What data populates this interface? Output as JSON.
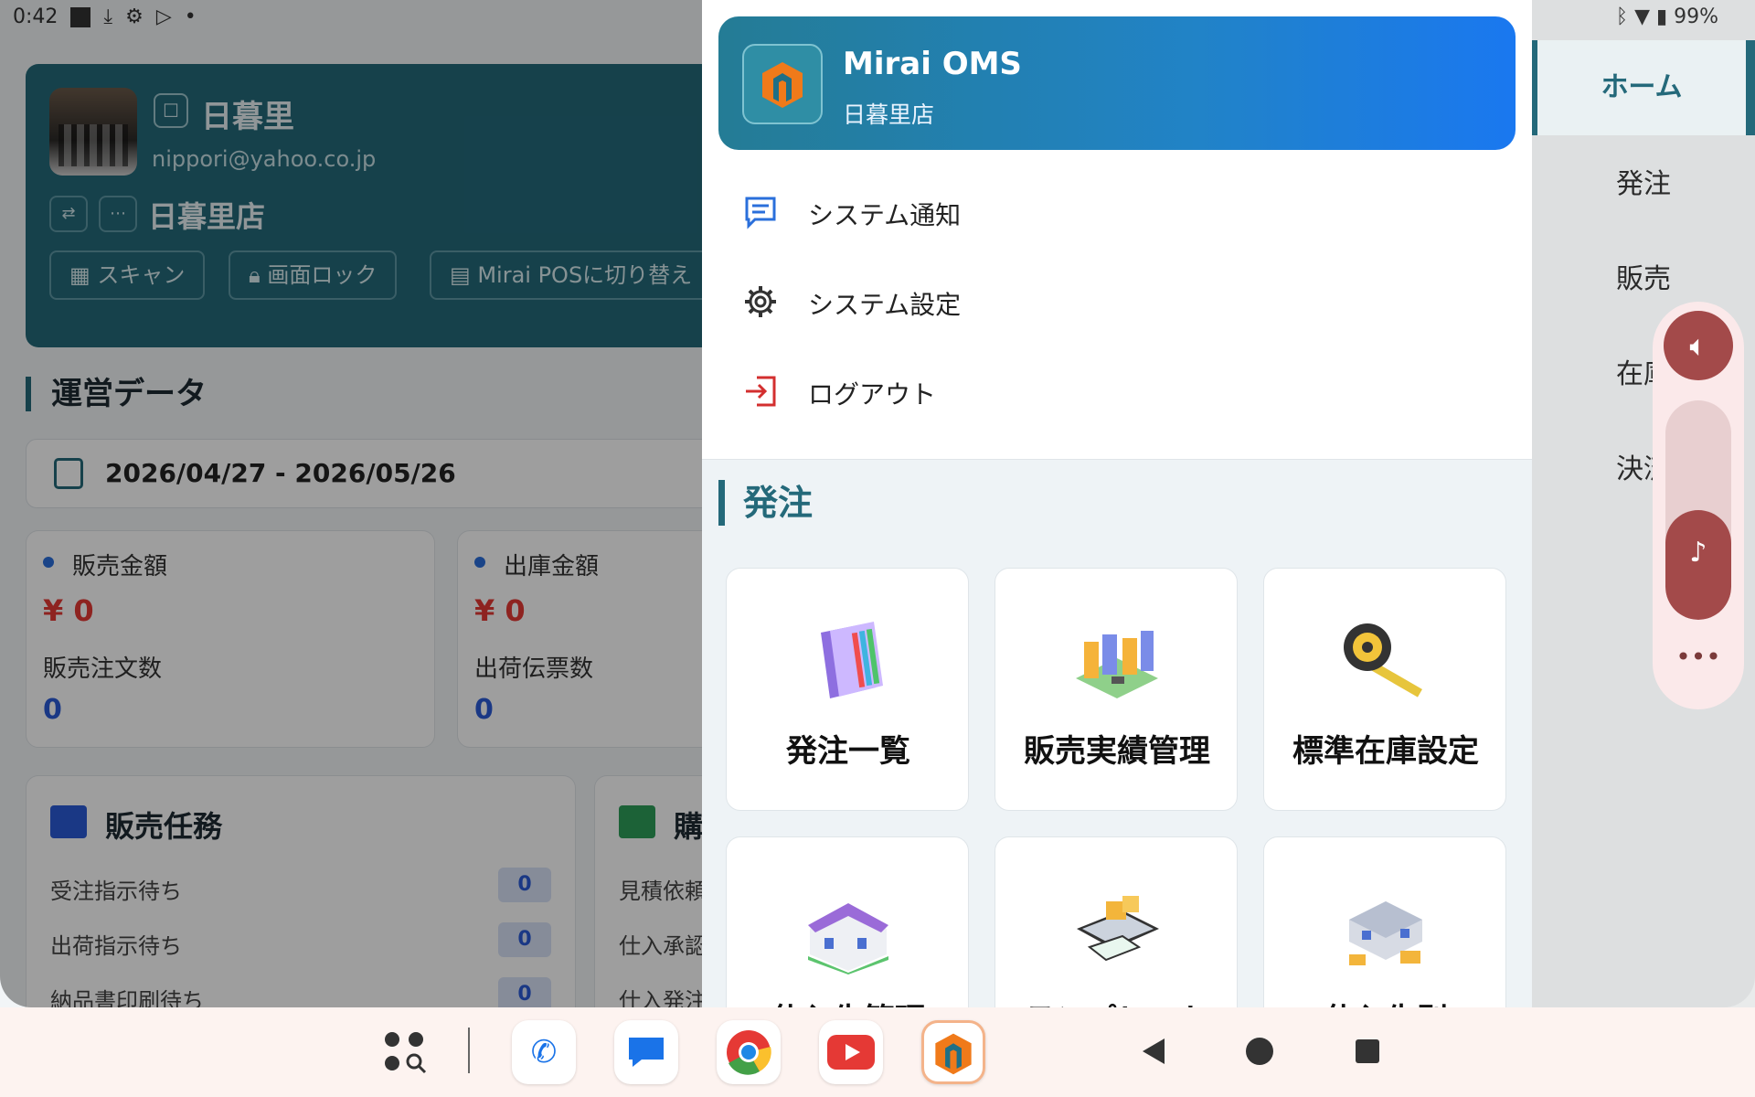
{
  "status_bar": {
    "time": "0:42",
    "battery": "99%"
  },
  "background": {
    "user": {
      "name": "日暮里",
      "email": "nippori@yahoo.co.jp",
      "store": "日暮里店"
    },
    "user_buttons": [
      "スキャン",
      "画面ロック",
      "Mirai POSに切り替え"
    ],
    "section_title": "運営データ",
    "date_range": "2026/04/27 - 2026/05/26",
    "stats": [
      {
        "label": "販売金額",
        "amount": "¥ 0",
        "sub_label": "販売注文数",
        "count": "0"
      },
      {
        "label": "出庫金額",
        "amount": "¥ 0",
        "sub_label": "出荷伝票数",
        "count": "0"
      }
    ],
    "sales_tasks": {
      "title": "販売任務",
      "rows": [
        {
          "label": "受注指示待ち",
          "count": "0"
        },
        {
          "label": "出荷指示待ち",
          "count": "0"
        },
        {
          "label": "納品書印刷待ち",
          "count": "0"
        }
      ]
    },
    "purchase_tasks": {
      "title": "購",
      "rows": [
        {
          "label": "見積依頼"
        },
        {
          "label": "仕入承認"
        },
        {
          "label": "仕入発注"
        }
      ]
    }
  },
  "drawer": {
    "app_name": "Mirai OMS",
    "store_name": "日暮里店",
    "menu": [
      {
        "label": "システム通知",
        "icon": "message-icon"
      },
      {
        "label": "システム設定",
        "icon": "gear-icon"
      },
      {
        "label": "ログアウト",
        "icon": "logout-icon"
      }
    ],
    "section_title": "発注",
    "tiles": [
      {
        "label": "発注一覧",
        "icon": "binder-icon"
      },
      {
        "label": "販売実績管理",
        "icon": "warehouse-shelves-icon"
      },
      {
        "label": "標準在庫設定",
        "icon": "tape-measure-icon"
      },
      {
        "label": "仕入先管理",
        "icon": "store-icon"
      },
      {
        "label": "テンプレート",
        "icon": "tablet-boxes-icon"
      },
      {
        "label": "仕入先別",
        "icon": "factory-icon"
      }
    ]
  },
  "right_nav": {
    "items": [
      "ホーム",
      "発注",
      "販売",
      "在庫",
      "決済"
    ],
    "active": "ホーム"
  },
  "volume": {
    "level": 0.5
  },
  "taskbar": {
    "apps": [
      "app-drawer-icon",
      "phone-icon",
      "messages-icon",
      "chrome-icon",
      "youtube-icon",
      "mirai-oms-icon"
    ]
  },
  "colors": {
    "primary": "#24697a",
    "accent_blue": "#1a78f0",
    "danger": "#e53935"
  }
}
